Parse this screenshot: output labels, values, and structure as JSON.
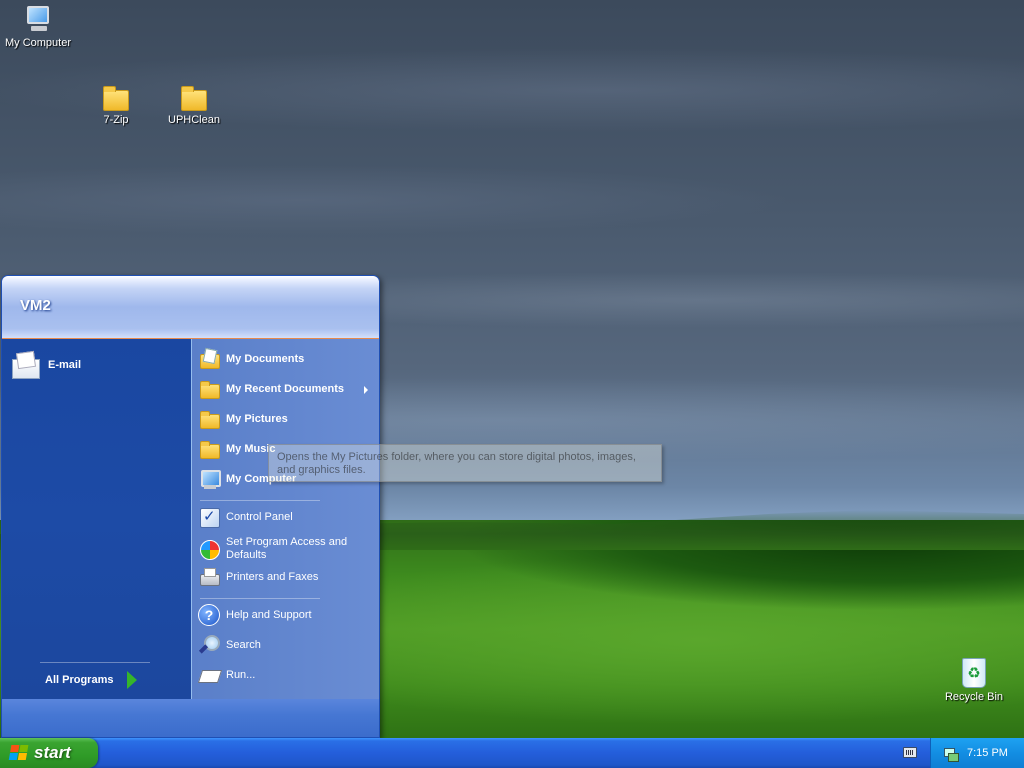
{
  "desktop": {
    "icons": [
      {
        "label": "My Computer",
        "icon": "my-computer-icon"
      },
      {
        "label": "7-Zip",
        "icon": "folder-icon"
      },
      {
        "label": "UPHClean",
        "icon": "folder-icon"
      },
      {
        "label": "Recycle Bin",
        "icon": "recycle-bin-icon"
      }
    ]
  },
  "start_menu": {
    "user_name": "VM2",
    "pinned": [
      {
        "label": "E-mail",
        "icon": "email-icon"
      }
    ],
    "all_programs_label": "All Programs",
    "places": [
      {
        "label": "My Documents",
        "icon": "my-documents-icon"
      },
      {
        "label": "My Recent Documents",
        "icon": "folder-icon",
        "has_submenu": true
      },
      {
        "label": "My Pictures",
        "icon": "folder-icon"
      },
      {
        "label": "My Music",
        "icon": "folder-icon"
      },
      {
        "label": "My Computer",
        "icon": "my-computer-icon"
      }
    ],
    "settings": [
      {
        "label": "Control Panel",
        "icon": "control-panel-icon"
      },
      {
        "label": "Set Program Access and Defaults",
        "icon": "program-defaults-icon"
      },
      {
        "label": "Printers and Faxes",
        "icon": "printer-icon"
      }
    ],
    "tools": [
      {
        "label": "Help and Support",
        "icon": "help-icon"
      },
      {
        "label": "Search",
        "icon": "search-icon"
      },
      {
        "label": "Run...",
        "icon": "run-icon"
      }
    ]
  },
  "tooltip": {
    "text": "Opens the My Pictures folder, where you can store digital photos, images, and graphics files."
  },
  "taskbar": {
    "start_label": "start",
    "clock": "7:15 PM"
  },
  "colors": {
    "taskbar_blue": "#245edb",
    "start_green": "#2f9b27",
    "menu_left_blue": "#1d4ba6",
    "menu_right_blue": "#6a8dd4",
    "tray_blue": "#138ee3"
  }
}
